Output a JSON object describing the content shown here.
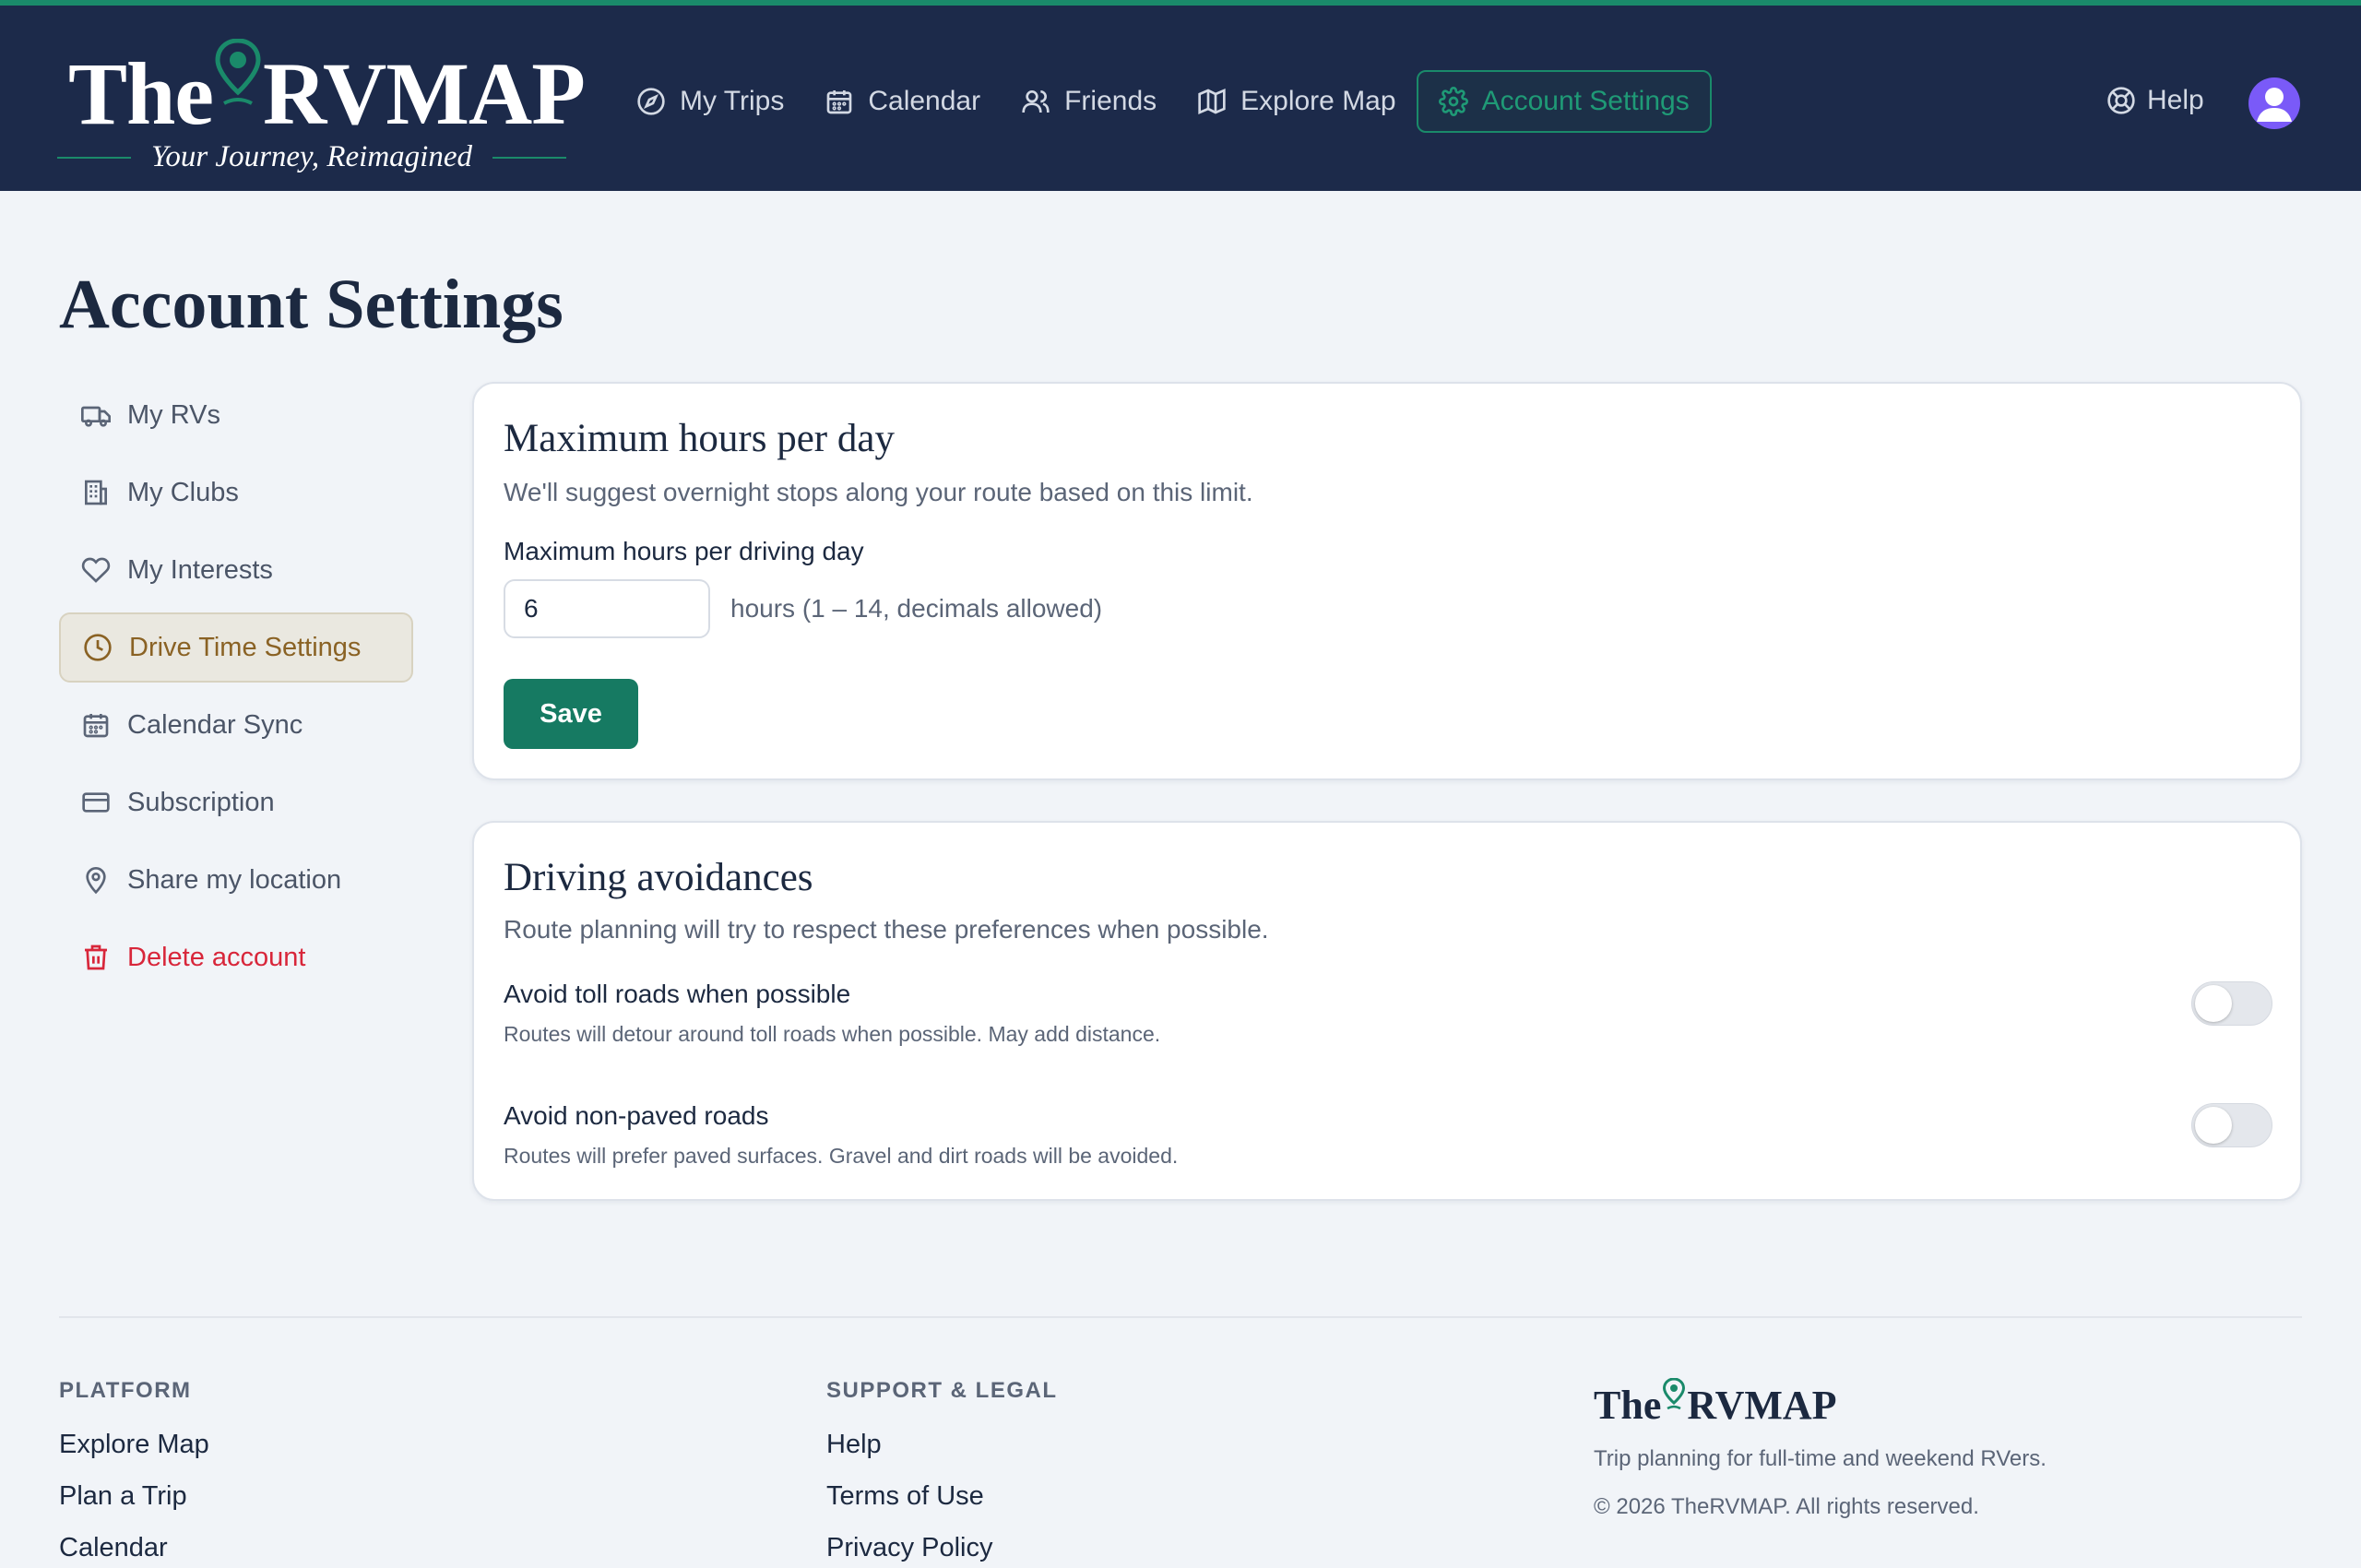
{
  "brand": {
    "logo_left": "The",
    "logo_right": "RVMAP",
    "tagline": "Your Journey, Reimagined",
    "accent_color": "#1a8a6a",
    "header_color": "#1c2a4a"
  },
  "nav": {
    "items": [
      {
        "label": "My Trips",
        "icon": "compass-icon"
      },
      {
        "label": "Calendar",
        "icon": "calendar-icon"
      },
      {
        "label": "Friends",
        "icon": "users-icon"
      },
      {
        "label": "Explore Map",
        "icon": "map-icon"
      },
      {
        "label": "Account Settings",
        "icon": "gear-icon",
        "active": true
      }
    ],
    "help_label": "Help",
    "avatar_icon": "user-avatar-icon"
  },
  "page": {
    "title": "Account Settings"
  },
  "side_menu": {
    "items": [
      {
        "label": "My RVs",
        "icon": "truck-icon"
      },
      {
        "label": "My Clubs",
        "icon": "building-icon"
      },
      {
        "label": "My Interests",
        "icon": "heart-icon"
      },
      {
        "label": "Drive Time Settings",
        "icon": "clock-icon",
        "active": true
      },
      {
        "label": "Calendar Sync",
        "icon": "calendar-icon"
      },
      {
        "label": "Subscription",
        "icon": "credit-card-icon"
      },
      {
        "label": "Share my location",
        "icon": "map-pin-icon"
      },
      {
        "label": "Delete account",
        "icon": "trash-icon",
        "danger": true
      }
    ]
  },
  "max_hours": {
    "title": "Maximum hours per day",
    "subtitle": "We'll suggest overnight stops along your route based on this limit.",
    "field_label": "Maximum hours per driving day",
    "value": "6",
    "hint": "hours (1 – 14, decimals allowed)",
    "save_label": "Save"
  },
  "avoidances": {
    "title": "Driving avoidances",
    "subtitle": "Route planning will try to respect these preferences when possible.",
    "options": [
      {
        "title": "Avoid toll roads when possible",
        "description": "Routes will detour around toll roads when possible. May add distance.",
        "enabled": false
      },
      {
        "title": "Avoid non-paved roads",
        "description": "Routes will prefer paved surfaces. Gravel and dirt roads will be avoided.",
        "enabled": false
      }
    ]
  },
  "footer": {
    "platform": {
      "heading": "PLATFORM",
      "links": [
        "Explore Map",
        "Plan a Trip",
        "Calendar"
      ]
    },
    "support": {
      "heading": "SUPPORT & LEGAL",
      "links": [
        "Help",
        "Terms of Use",
        "Privacy Policy"
      ]
    },
    "brand_left": "The",
    "brand_right": "RVMAP",
    "tagline": "Trip planning for full-time and weekend RVers.",
    "copyright": "© 2026 TheRVMAP. All rights reserved."
  }
}
